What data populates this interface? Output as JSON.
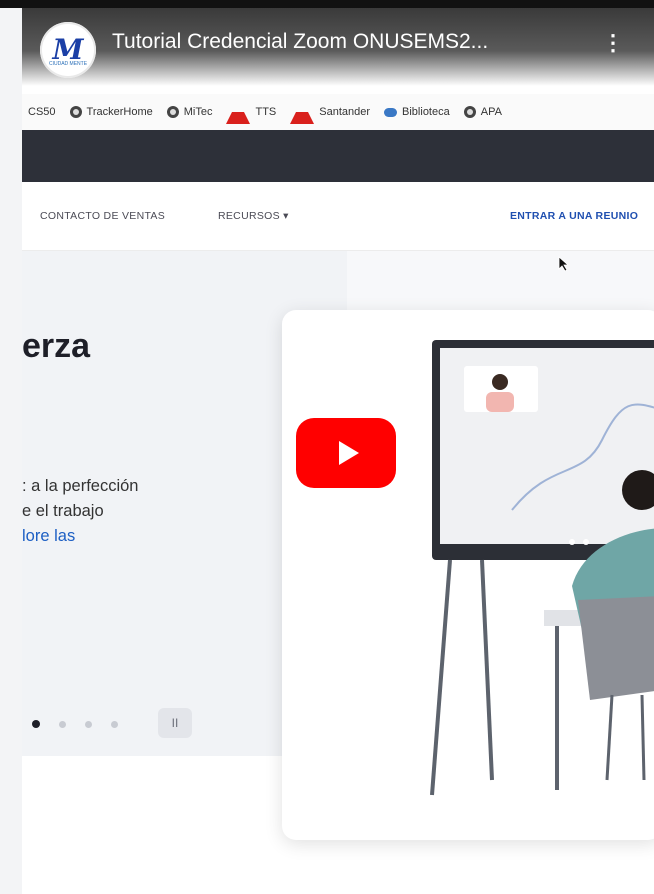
{
  "video_overlay": {
    "title": "Tutorial Credencial Zoom ONUSEMS2...",
    "channel_avatar_text": "CIUDAD MENTE",
    "menu_glyph": "⋮"
  },
  "bookmarks": [
    {
      "label": "CS50",
      "icon": "none"
    },
    {
      "label": "TrackerHome",
      "icon": "globe-icon"
    },
    {
      "label": "MiTec",
      "icon": "globe-icon"
    },
    {
      "label": "TTS",
      "icon": "santander-icon"
    },
    {
      "label": "Santander",
      "icon": "santander-icon"
    },
    {
      "label": "Biblioteca",
      "icon": "cloud-icon"
    },
    {
      "label": "APA",
      "icon": "globe-icon"
    }
  ],
  "nav": {
    "contact_sales": "CONTACTO DE VENTAS",
    "resources": "RECURSOS",
    "resources_caret": "▾",
    "join_meeting": "ENTRAR A UNA REUNIO"
  },
  "hero": {
    "heading": "erza",
    "line1": ": a la perfección",
    "line2": "e el trabajo",
    "link_text": "lore las",
    "pause_glyph": "II"
  },
  "colors": {
    "youtube_red": "#ff0000",
    "join_link_blue": "#1f4fb0",
    "dark_band": "#2d3039"
  }
}
